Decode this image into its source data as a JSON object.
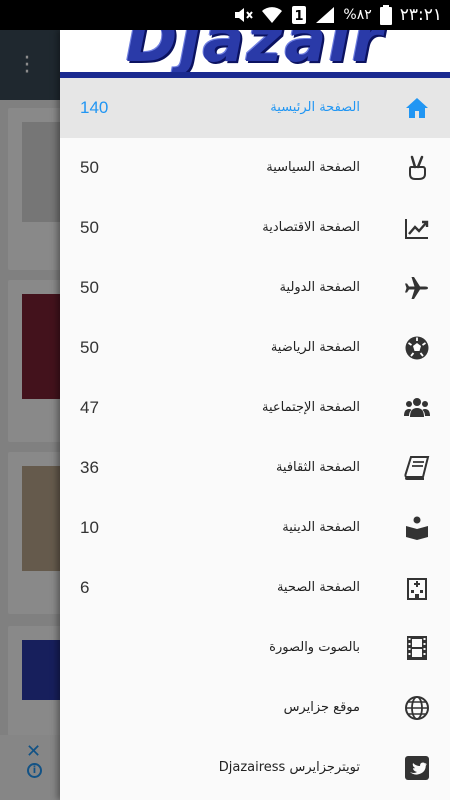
{
  "status_bar": {
    "time": "٢٣:٢١",
    "battery": "%٨٢",
    "sim_indicator": "1",
    "icons": [
      "mute-icon",
      "wifi-icon",
      "sim-icon",
      "signal-icon",
      "battery-icon"
    ]
  },
  "drawer": {
    "header_logo_text": "Djazair ess",
    "accent_color": "#2196F3",
    "items": [
      {
        "label": "الصفحة الرئيسية",
        "count": "140",
        "icon": "home-icon",
        "active": true
      },
      {
        "label": "الصفحة السياسية",
        "count": "50",
        "icon": "victory-hand-icon",
        "active": false
      },
      {
        "label": "الصفحة الاقتصادية",
        "count": "50",
        "icon": "trending-up-icon",
        "active": false
      },
      {
        "label": "الصفحة الدولية",
        "count": "50",
        "icon": "airplane-icon",
        "active": false
      },
      {
        "label": "الصفحة الرياضية",
        "count": "50",
        "icon": "soccer-ball-icon",
        "active": false
      },
      {
        "label": "الصفحة الإجتماعية",
        "count": "47",
        "icon": "group-icon",
        "active": false
      },
      {
        "label": "الصفحة الثقافية",
        "count": "36",
        "icon": "book-icon",
        "active": false
      },
      {
        "label": "الصفحة الدينية",
        "count": "10",
        "icon": "reading-person-icon",
        "active": false
      },
      {
        "label": "الصفحة الصحية",
        "count": "6",
        "icon": "hospital-icon",
        "active": false
      },
      {
        "label": "بالصوت والصورة",
        "count": "",
        "icon": "film-icon",
        "active": false
      },
      {
        "label": "موقع جزايرس",
        "count": "",
        "icon": "globe-icon",
        "active": false
      },
      {
        "label": "تويترجزايرس Djazairess",
        "count": "",
        "icon": "twitter-icon",
        "active": false
      }
    ]
  }
}
